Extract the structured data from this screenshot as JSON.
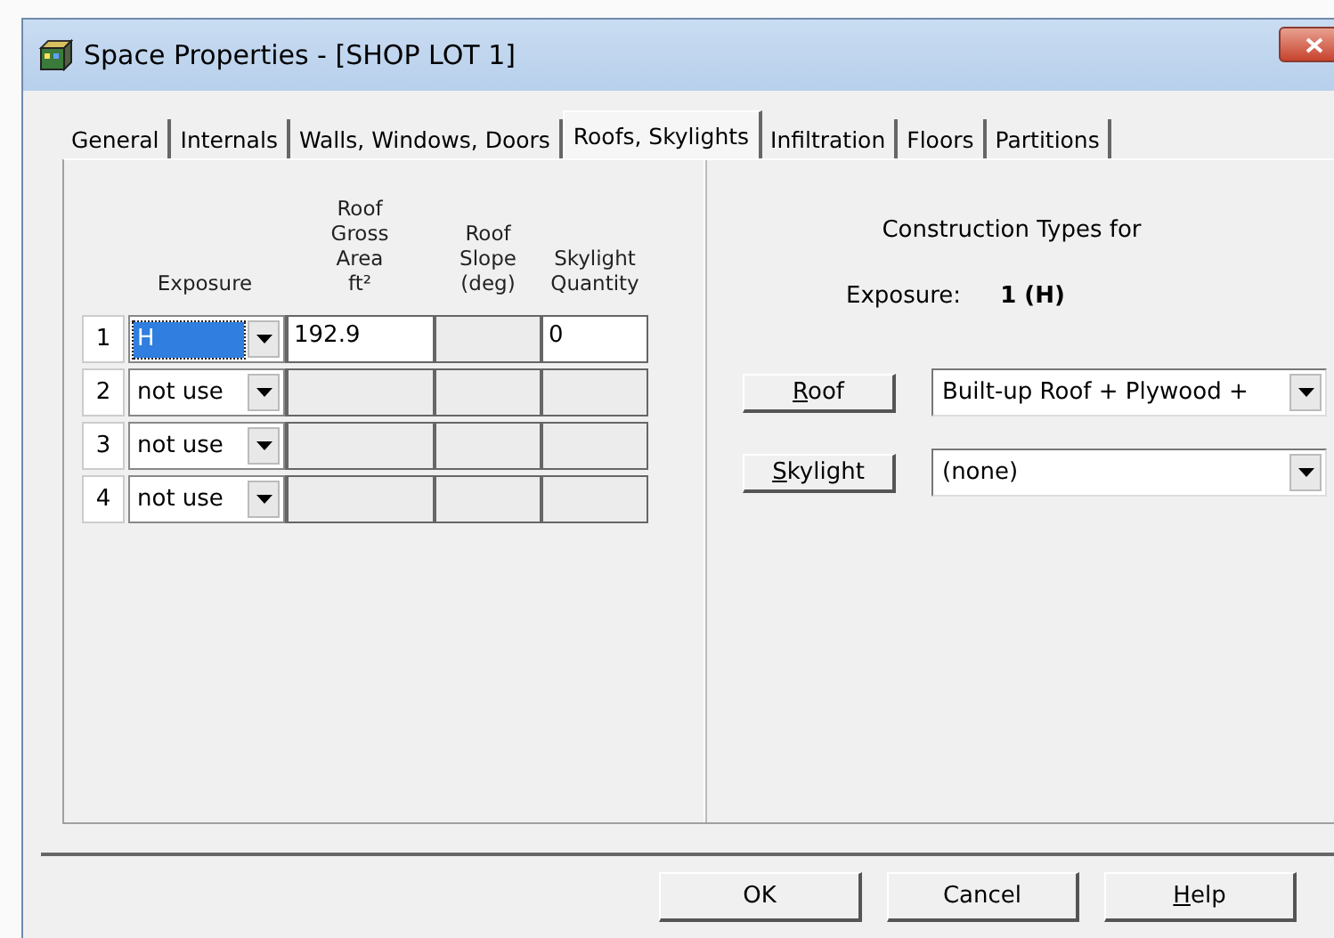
{
  "window": {
    "title": "Space Properties - [SHOP LOT 1]"
  },
  "tabs": [
    {
      "label": "General",
      "selected": false
    },
    {
      "label": "Internals",
      "selected": false
    },
    {
      "label": "Walls, Windows, Doors",
      "selected": false
    },
    {
      "label": "Roofs, Skylights",
      "selected": true
    },
    {
      "label": "Infiltration",
      "selected": false
    },
    {
      "label": "Floors",
      "selected": false
    },
    {
      "label": "Partitions",
      "selected": false
    }
  ],
  "grid": {
    "columns": [
      "Exposure",
      "Roof\nGross\nArea\nft²",
      "Roof\nSlope\n(deg)",
      "Skylight\nQuantity"
    ],
    "rows": [
      {
        "number": "1",
        "cells": [
          {
            "kind": "combo",
            "value": "H",
            "selected": true
          },
          {
            "kind": "text",
            "value": "192.9",
            "disabled": false
          },
          {
            "kind": "text",
            "disabled": true
          },
          {
            "kind": "text",
            "value": "0",
            "disabled": false
          }
        ]
      },
      {
        "number": "2",
        "cells": [
          {
            "kind": "combo",
            "value": "not use",
            "selected": false
          },
          {
            "kind": "text",
            "disabled": true
          },
          {
            "kind": "text",
            "disabled": true
          },
          {
            "kind": "text",
            "disabled": true
          }
        ]
      },
      {
        "number": "3",
        "cells": [
          {
            "kind": "combo",
            "value": "not use",
            "selected": false
          },
          {
            "kind": "text",
            "disabled": true
          },
          {
            "kind": "text",
            "disabled": true
          },
          {
            "kind": "text",
            "disabled": true
          }
        ]
      },
      {
        "number": "4",
        "cells": [
          {
            "kind": "combo",
            "value": "not use",
            "selected": false
          },
          {
            "kind": "text",
            "disabled": true
          },
          {
            "kind": "text",
            "disabled": true
          },
          {
            "kind": "text",
            "disabled": true
          }
        ]
      }
    ]
  },
  "construction": {
    "heading": "Construction Types for",
    "exposure_label": "Exposure:",
    "exposure_value": "1 (H)",
    "types": [
      {
        "button": "Roof",
        "accelerator": true,
        "value": "Built-up Roof + Plywood +"
      },
      {
        "button": "Skylight",
        "accelerator": true,
        "value": "(none)"
      }
    ]
  },
  "buttons": [
    {
      "label": "OK",
      "accelerator": false
    },
    {
      "label": "Cancel",
      "accelerator": false
    },
    {
      "label": "Help",
      "accelerator": true
    }
  ]
}
